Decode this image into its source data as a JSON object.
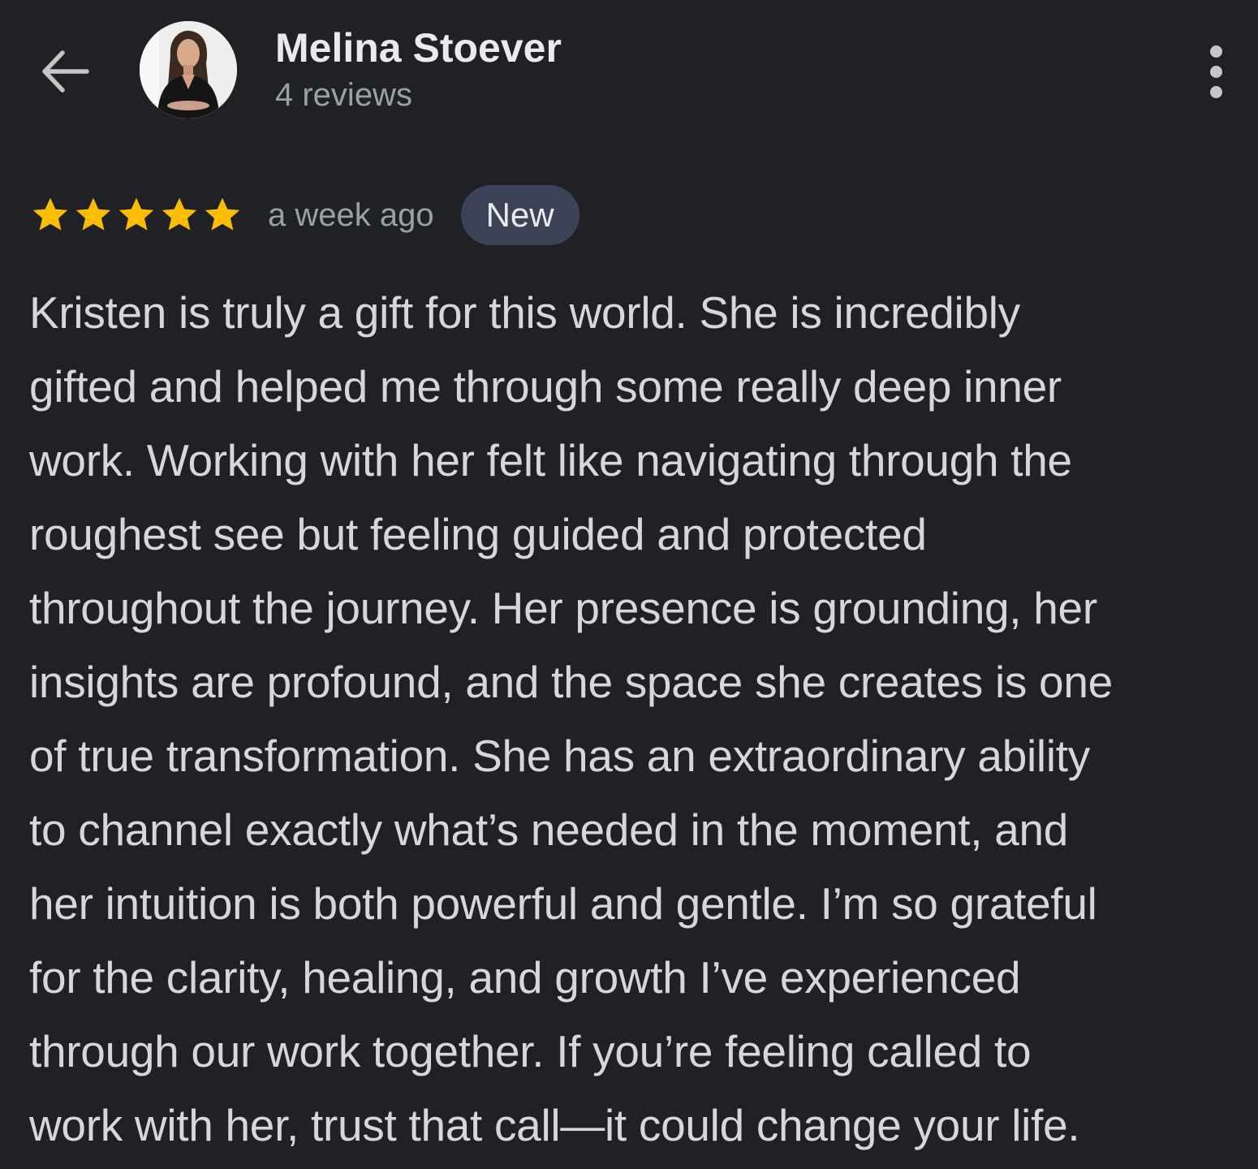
{
  "header": {
    "back_icon": "arrow-back-icon",
    "avatar_icon": "reviewer-avatar",
    "name": "Melina Stoever",
    "review_count": "4 reviews",
    "more_icon": "more-vertical-icon"
  },
  "review": {
    "rating": 5,
    "max_rating": 5,
    "star_icon": "star-icon",
    "star_color": "#fbbc04",
    "time_ago": "a week ago",
    "badge": "New",
    "lines": [
      "Kristen is truly a gift for this world. She is incredibly",
      "gifted and helped me through some really deep inner",
      "work. Working with her felt like navigating through the",
      "roughest see but feeling guided and protected",
      "throughout the journey. Her presence is grounding, her",
      "insights are profound, and the space she creates is one",
      "of true transformation. She has an extraordinary ability",
      "to channel exactly what’s needed in the moment, and",
      "her intuition is both powerful and gentle. I’m so grateful",
      "for the clarity, healing, and growth I’ve experienced",
      "through our work together. If you’re feeling called to",
      "work with her, trust that call—it could change your life."
    ]
  },
  "colors": {
    "background": "#202124",
    "primary_text": "#e8eaed",
    "secondary_text": "#9aa0a6",
    "badge_background": "#3c4356"
  }
}
